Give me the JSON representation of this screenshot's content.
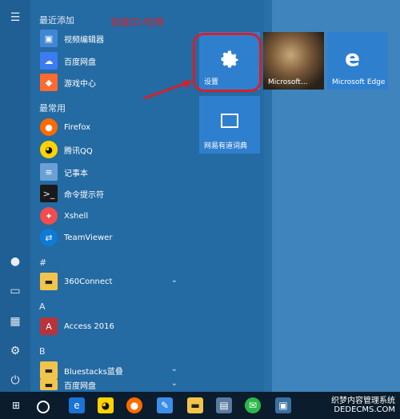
{
  "annotation": "百度ID:吃嘿",
  "sections": {
    "recent": "最近添加",
    "frequent": "最常用",
    "hash": "#",
    "a": "A",
    "b": "B"
  },
  "items": [
    {
      "label": "视频编辑器",
      "color": "#3f87d6",
      "icon": "video-editor-icon"
    },
    {
      "label": "百度网盘",
      "color": "#3c7cf0",
      "icon": "baidu-pan-icon"
    },
    {
      "label": "游戏中心",
      "color": "#ff6a2e",
      "icon": "game-center-icon"
    },
    {
      "label": "Firefox",
      "color": "#ff6a00",
      "icon": "firefox-icon"
    },
    {
      "label": "腾讯QQ",
      "color": "#ffd400",
      "icon": "qq-icon"
    },
    {
      "label": "记事本",
      "color": "#6aa0d6",
      "icon": "notepad-icon"
    },
    {
      "label": "命令提示符",
      "color": "#1a1a1a",
      "icon": "cmd-icon"
    },
    {
      "label": "Xshell",
      "color": "#f04d4d",
      "icon": "xshell-icon"
    },
    {
      "label": "TeamViewer",
      "color": "#0e7bd8",
      "icon": "teamviewer-icon"
    },
    {
      "label": "360Connect",
      "color": "#f3c44b",
      "icon": "folder-icon"
    },
    {
      "label": "Access 2016",
      "color": "#b7343a",
      "icon": "access-icon"
    },
    {
      "label": "Bluestacks蓝叠",
      "color": "#f3c44b",
      "icon": "folder-icon"
    },
    {
      "label": "百度网盘",
      "color": "#f3c44b",
      "icon": "folder-icon"
    }
  ],
  "tiles": {
    "settings": "设置",
    "news": "Microsoft...",
    "edge": "Microsoft Edge",
    "dict": "网易有道词典"
  },
  "watermark": {
    "line1": "织梦内容管理系统",
    "line2": "DEDECMS.COM"
  }
}
